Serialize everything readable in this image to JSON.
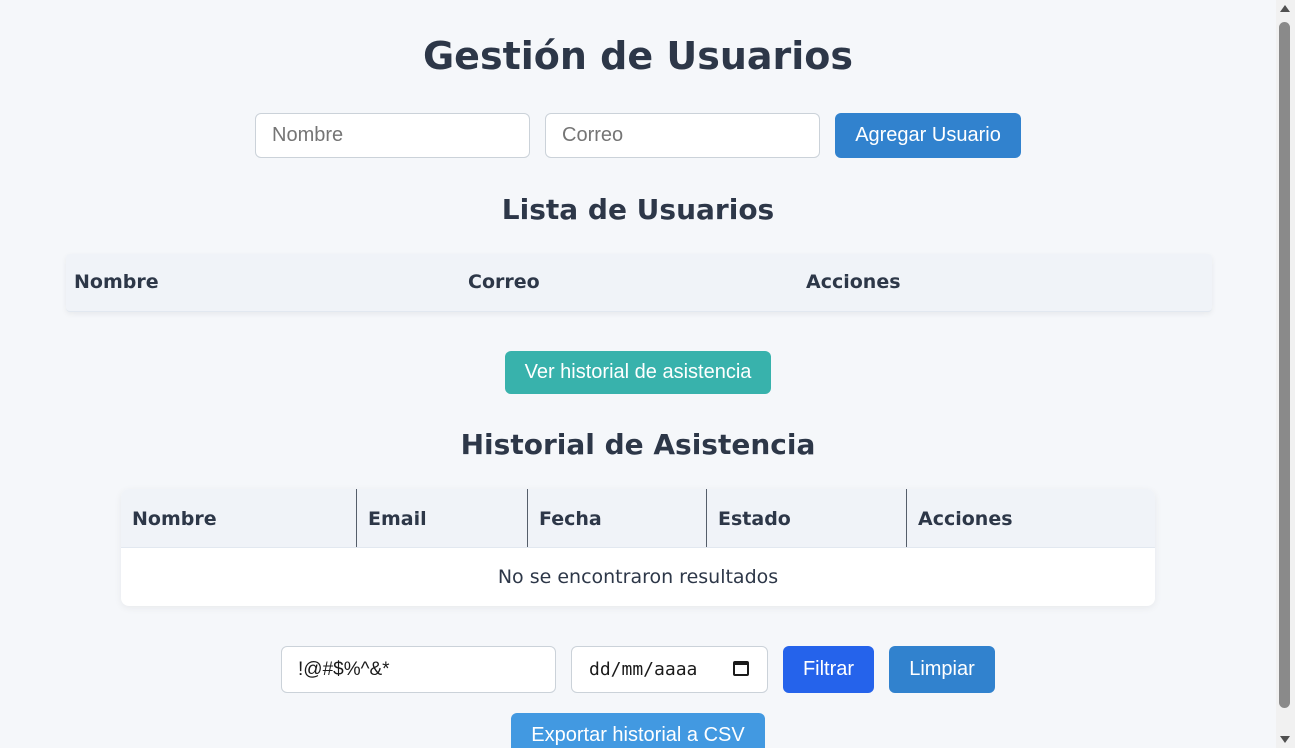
{
  "header": {
    "title": "Gestión de Usuarios"
  },
  "add_user_form": {
    "name_placeholder": "Nombre",
    "email_placeholder": "Correo",
    "add_button": "Agregar Usuario"
  },
  "users_section": {
    "title": "Lista de Usuarios",
    "columns": [
      "Nombre",
      "Correo",
      "Acciones"
    ],
    "rows": []
  },
  "history_button": "Ver historial de asistencia",
  "history_section": {
    "title": "Historial de Asistencia",
    "columns": [
      "Nombre",
      "Email",
      "Fecha",
      "Estado",
      "Acciones"
    ],
    "empty_message": "No se encontraron resultados"
  },
  "filters": {
    "text_value": "!@#$%^&*",
    "date_placeholder": "dd/mm/aaaa",
    "filter_button": "Filtrar",
    "clear_button": "Limpiar"
  },
  "export_button": "Exportar historial a CSV",
  "icons": {
    "calendar": "calendar-icon"
  }
}
